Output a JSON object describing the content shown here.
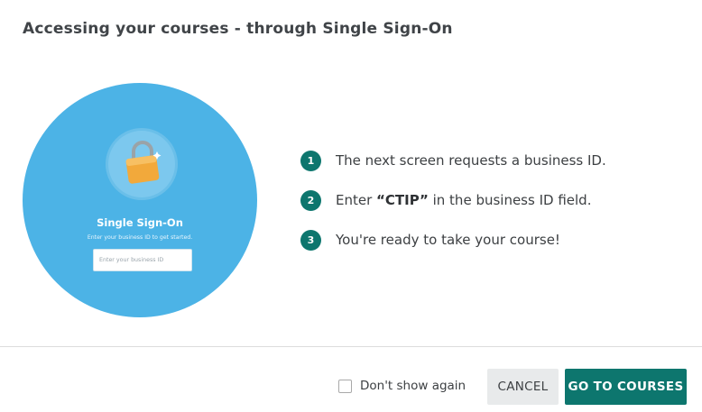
{
  "dialog": {
    "title": "Accessing your courses - through Single Sign-On"
  },
  "illustration": {
    "heading": "Single Sign-On",
    "subtitle": "Enter your business ID to get started.",
    "input_placeholder": "Enter your business ID",
    "icon": "lock-icon"
  },
  "steps": [
    {
      "number": "1",
      "text": "The next screen requests a business ID."
    },
    {
      "number": "2",
      "text_before": "Enter ",
      "highlight": "“CTIP”",
      "text_after": " in the business ID field."
    },
    {
      "number": "3",
      "text": "You're ready to take your course!"
    }
  ],
  "footer": {
    "dont_show_label": "Don't show again",
    "dont_show_checked": false,
    "cancel_label": "CANCEL",
    "go_label": "GO TO COURSES"
  },
  "colors": {
    "accent": "#0d766e",
    "illustration_bg": "#4cb3e6",
    "lock": "#f2a93b"
  }
}
